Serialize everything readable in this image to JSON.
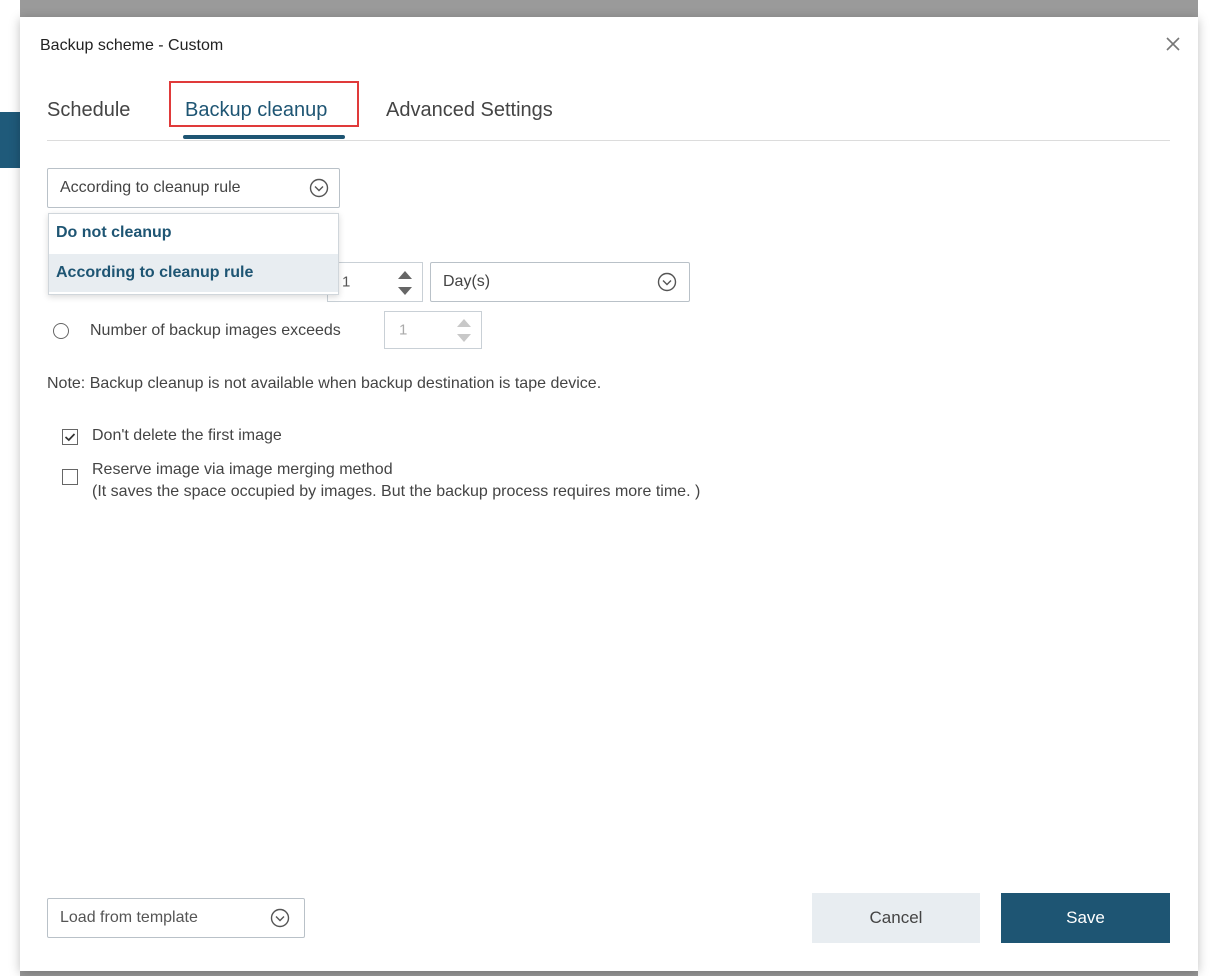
{
  "dialog": {
    "title": "Backup scheme - Custom",
    "tabs": [
      {
        "label": "Schedule"
      },
      {
        "label": "Backup cleanup"
      },
      {
        "label": "Advanced Settings"
      }
    ]
  },
  "cleanup": {
    "mode_selected": "According to cleanup rule",
    "options": [
      "Do not cleanup",
      "According to cleanup rule"
    ],
    "age_value": "1",
    "age_unit": "Day(s)",
    "count_rule_label": "Number of backup images exceeds",
    "count_value": "1",
    "note": "Note: Backup cleanup is not available when backup destination is tape device.",
    "keep_first_label": "Don't delete the first image",
    "keep_first_checked": true,
    "merge_label": "Reserve image via image merging method",
    "merge_desc": "(It saves the space occupied by images. But the backup process requires more time. )",
    "merge_checked": false
  },
  "footer": {
    "template_placeholder": "Load from template",
    "cancel_label": "Cancel",
    "save_label": "Save"
  },
  "colors": {
    "accent": "#1e5573",
    "highlight": "#e03a3a"
  }
}
